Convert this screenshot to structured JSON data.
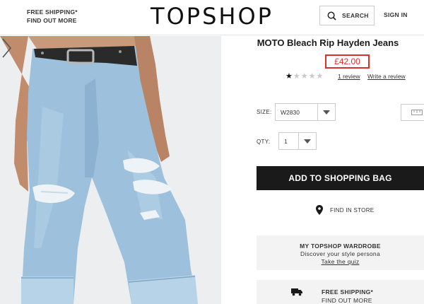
{
  "header": {
    "shipping_line1": "FREE SHIPPING*",
    "shipping_line2": "FIND OUT MORE",
    "logo": "TOPSHOP",
    "search_label": "SEARCH",
    "signin_label": "SIGN IN"
  },
  "product": {
    "title": "MOTO Bleach Rip Hayden Jeans",
    "price": "£42.00",
    "rating": 1,
    "rating_max": 5,
    "review_link": "1 review",
    "write_review": "Write a review",
    "size_label": "SIZE:",
    "size_value": "W2830",
    "qty_label": "QTY:",
    "qty_value": "1",
    "add_to_bag": "ADD TO SHOPPING BAG",
    "find_in_store": "FIND IN STORE"
  },
  "wardrobe": {
    "title": "MY TOPSHOP WARDROBE",
    "subtitle": "Discover your style persona",
    "link": "Take the quiz"
  },
  "shipping_box": {
    "line1": "FREE SHIPPING*",
    "line2": "FIND OUT MORE"
  },
  "colors": {
    "accent_red": "#d9302c",
    "button_dark": "#1a1a1a",
    "denim": "#9dc1dc"
  },
  "icons": [
    "search-icon",
    "chevron-down-icon",
    "map-pin-icon",
    "truck-icon",
    "chevron-right-icon",
    "star-icon",
    "ruler-icon"
  ]
}
